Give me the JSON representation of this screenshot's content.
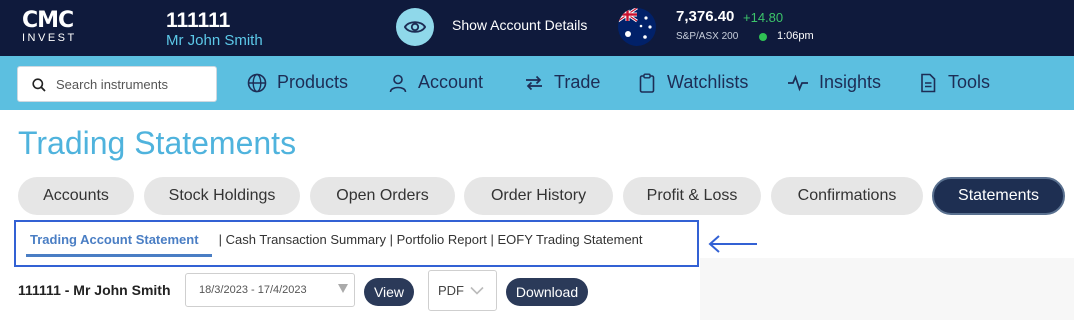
{
  "header": {
    "logo_main": "CMC",
    "logo_sub": "INVEST",
    "account_number": "111111",
    "account_name": "Mr John Smith",
    "show_details_label": "Show Account Details",
    "index_value": "7,376.40",
    "index_change": "+14.80",
    "index_name": "S&P/ASX 200",
    "index_time": "1:06pm",
    "change_color": "#3cc46a",
    "market_open_color": "#2fc154"
  },
  "nav": {
    "search_placeholder": "Search instruments",
    "items": [
      {
        "label": "Products",
        "icon": "globe-icon"
      },
      {
        "label": "Account",
        "icon": "user-icon"
      },
      {
        "label": "Trade",
        "icon": "swap-arrows-icon"
      },
      {
        "label": "Watchlists",
        "icon": "clipboard-icon"
      },
      {
        "label": "Insights",
        "icon": "pulse-icon"
      },
      {
        "label": "Tools",
        "icon": "document-icon"
      }
    ]
  },
  "page": {
    "title": "Trading Statements",
    "tabs": [
      {
        "label": "Accounts",
        "active": false
      },
      {
        "label": "Stock Holdings",
        "active": false
      },
      {
        "label": "Open Orders",
        "active": false
      },
      {
        "label": "Order History",
        "active": false
      },
      {
        "label": "Profit & Loss",
        "active": false
      },
      {
        "label": "Confirmations",
        "active": false
      },
      {
        "label": "Statements",
        "active": true
      }
    ],
    "subtabs": {
      "active": "Trading Account Statement",
      "others": " | Cash Transaction Summary | Portfolio Report | EOFY Trading Statement"
    },
    "statement_row": {
      "account_label": "111111 - Mr John Smith",
      "date_range": "18/3/2023 - 17/4/2023",
      "view_label": "View",
      "format_value": "PDF",
      "download_label": "Download"
    }
  },
  "colors": {
    "topbar": "#0f1a3c",
    "navbar": "#5cbfe0",
    "title": "#4fb3dd",
    "active_tab": "#1e2f52",
    "highlight_box": "#3361d4"
  }
}
